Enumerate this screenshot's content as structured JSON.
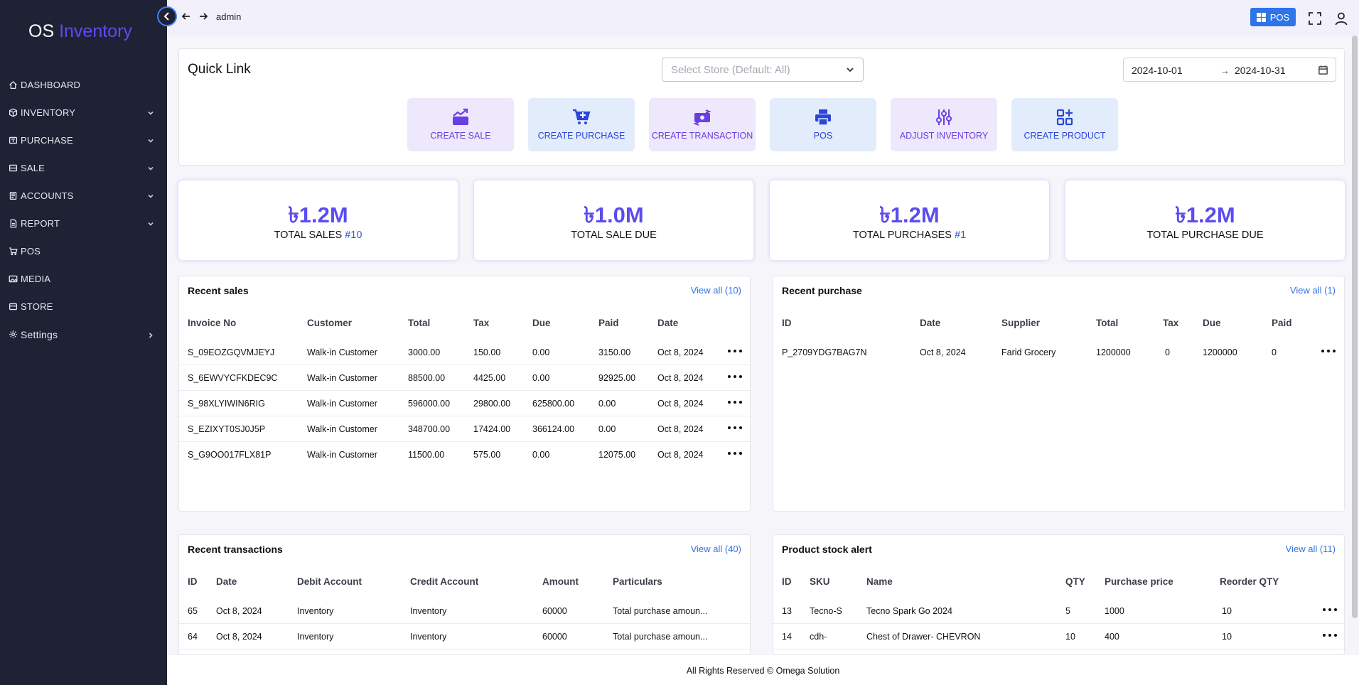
{
  "app": {
    "brand_prefix": "OS",
    "brand_name": "Inventory"
  },
  "sidebar": {
    "items": [
      {
        "label": "DASHBOARD",
        "icon": "home-icon"
      },
      {
        "label": "INVENTORY",
        "icon": "cube-icon"
      },
      {
        "label": "PURCHASE",
        "icon": "purchase-icon"
      },
      {
        "label": "SALE",
        "icon": "sale-icon"
      },
      {
        "label": "ACCOUNTS",
        "icon": "accounts-icon"
      },
      {
        "label": "REPORT",
        "icon": "report-icon"
      },
      {
        "label": "POS",
        "icon": "cart-icon"
      },
      {
        "label": "MEDIA",
        "icon": "media-icon"
      },
      {
        "label": "STORE",
        "icon": "store-icon"
      },
      {
        "label": "Settings",
        "icon": "gear-icon"
      }
    ]
  },
  "topbar": {
    "user": "admin",
    "pos_label": "POS"
  },
  "quick_link": {
    "title": "Quick Link",
    "store_placeholder": "Select Store (Default: All)",
    "date_from": "2024-10-01",
    "date_to": "2024-10-31",
    "buttons": [
      {
        "label": "CREATE SALE"
      },
      {
        "label": "CREATE PURCHASE"
      },
      {
        "label": "CREATE TRANSACTION"
      },
      {
        "label": "POS"
      },
      {
        "label": "ADJUST INVENTORY"
      },
      {
        "label": "CREATE PRODUCT"
      }
    ]
  },
  "stats": [
    {
      "value": "৳1.2M",
      "label": "TOTAL SALES",
      "hash": "#10"
    },
    {
      "value": "৳1.0M",
      "label": "TOTAL SALE DUE",
      "hash": ""
    },
    {
      "value": "৳1.2M",
      "label": "TOTAL PURCHASES",
      "hash": "#1"
    },
    {
      "value": "৳1.2M",
      "label": "TOTAL PURCHASE DUE",
      "hash": ""
    }
  ],
  "recent_sales": {
    "title": "Recent sales",
    "view_all": "View all (10)",
    "columns": [
      "Invoice No",
      "Customer",
      "Total",
      "Tax",
      "Due",
      "Paid",
      "Date"
    ],
    "rows": [
      [
        "S_09EOZGQVMJEYJ",
        "Walk-in Customer",
        "3000.00",
        "150.00",
        "0.00",
        "3150.00",
        "Oct 8, 2024"
      ],
      [
        "S_6EWVYCFKDEC9C",
        "Walk-in Customer",
        "88500.00",
        "4425.00",
        "0.00",
        "92925.00",
        "Oct 8, 2024"
      ],
      [
        "S_98XLYIWIN6RIG",
        "Walk-in Customer",
        "596000.00",
        "29800.00",
        "625800.00",
        "0.00",
        "Oct 8, 2024"
      ],
      [
        "S_EZIXYT0SJ0J5P",
        "Walk-in Customer",
        "348700.00",
        "17424.00",
        "366124.00",
        "0.00",
        "Oct 8, 2024"
      ],
      [
        "S_G9OO017FLX81P",
        "Walk-in Customer",
        "11500.00",
        "575.00",
        "0.00",
        "12075.00",
        "Oct 8, 2024"
      ]
    ]
  },
  "recent_purchase": {
    "title": "Recent purchase",
    "view_all": "View all (1)",
    "columns": [
      "ID",
      "Date",
      "Supplier",
      "Total",
      "Tax",
      "Due",
      "Paid"
    ],
    "rows": [
      [
        "P_2709YDG7BAG7N",
        "Oct 8, 2024",
        "Farid Grocery",
        "1200000",
        "0",
        "1200000",
        "0"
      ]
    ]
  },
  "recent_transactions": {
    "title": "Recent transactions",
    "view_all": "View all (40)",
    "columns": [
      "ID",
      "Date",
      "Debit Account",
      "Credit Account",
      "Amount",
      "Particulars"
    ],
    "rows": [
      [
        "65",
        "Oct 8, 2024",
        "Inventory",
        "Inventory",
        "60000",
        "Total purchase amoun..."
      ],
      [
        "64",
        "Oct 8, 2024",
        "Inventory",
        "Inventory",
        "60000",
        "Total purchase amoun..."
      ]
    ]
  },
  "stock_alert": {
    "title": "Product stock alert",
    "view_all": "View all (11)",
    "columns": [
      "ID",
      "SKU",
      "Name",
      "QTY",
      "Purchase price",
      "Reorder QTY"
    ],
    "rows": [
      [
        "13",
        "Tecno-S",
        "Tecno Spark Go 2024",
        "5",
        "1000",
        "10"
      ],
      [
        "14",
        "cdh-",
        "Chest of Drawer- CHEVRON",
        "10",
        "400",
        "10"
      ]
    ]
  },
  "footer": {
    "text": "All Rights Reserved © Omega Solution"
  }
}
